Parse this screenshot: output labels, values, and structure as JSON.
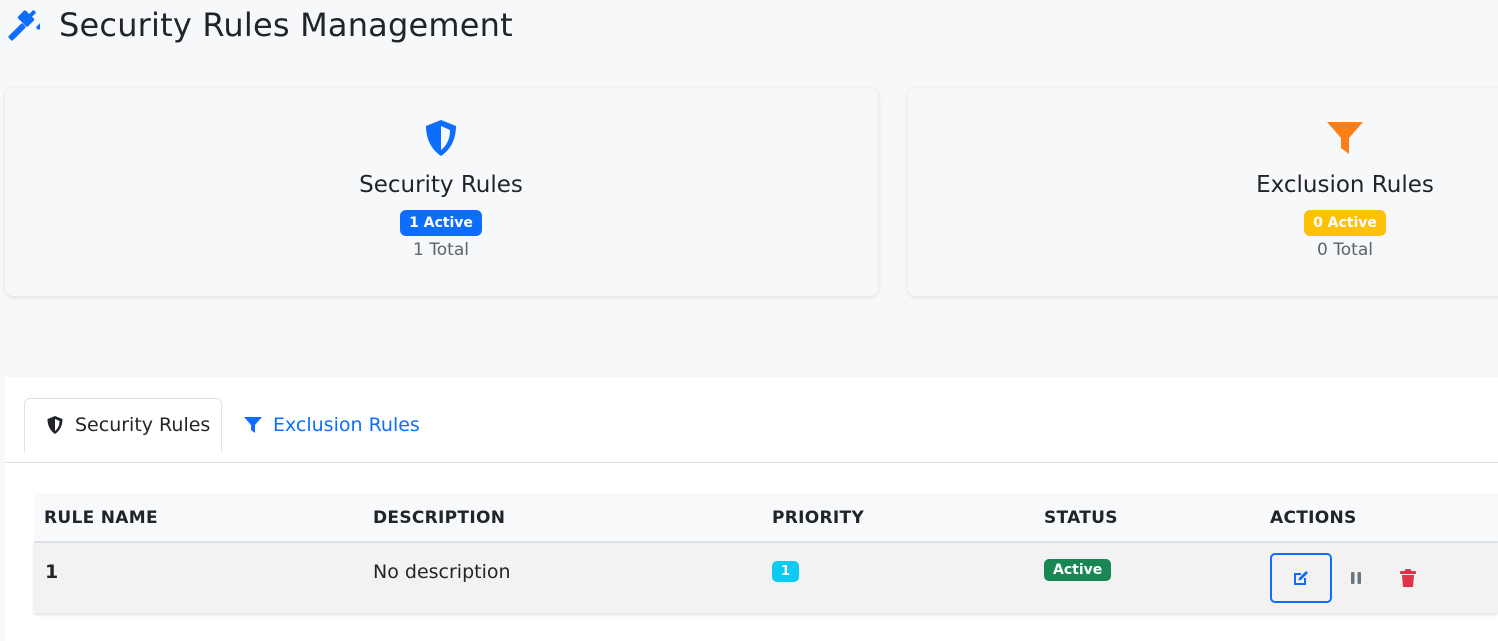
{
  "page": {
    "title": "Security Rules Management",
    "title_icon": "gavel-icon",
    "accent_color": "#0d6efd"
  },
  "cards": [
    {
      "icon": "shield-icon",
      "title": "Security Rules",
      "active_badge": "1 Active",
      "total": "1 Total",
      "badge_color": "#0d6efd",
      "icon_color": "#0d6efd"
    },
    {
      "icon": "filter-icon",
      "title": "Exclusion Rules",
      "active_badge": "0 Active",
      "total": "0 Total",
      "badge_color": "#ffc107",
      "icon_color": "#fd7e14"
    }
  ],
  "tabs": [
    {
      "label": "Security Rules",
      "icon": "shield-icon",
      "active": true
    },
    {
      "label": "Exclusion Rules",
      "icon": "filter-icon",
      "active": false
    }
  ],
  "table": {
    "columns": [
      "RULE NAME",
      "DESCRIPTION",
      "PRIORITY",
      "STATUS",
      "ACTIONS"
    ],
    "rows": [
      {
        "name": "1",
        "description": "No description",
        "priority": "1",
        "status": "Active",
        "actions": [
          "edit-icon",
          "pause-icon",
          "trash-icon"
        ]
      }
    ],
    "status_color": "#198754",
    "priority_color": "#0dcaf0",
    "delete_color": "#dc3545"
  }
}
